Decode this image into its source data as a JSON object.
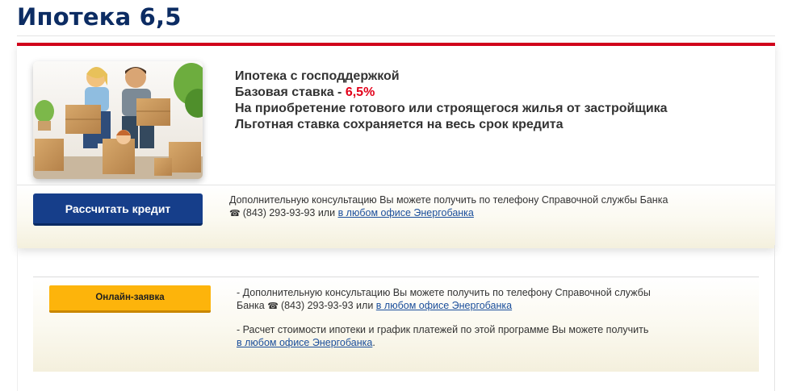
{
  "page": {
    "title": "Ипотека 6,5"
  },
  "card": {
    "features": [
      "Ипотека с господдержкой",
      "Базовая ставка - ",
      "На приобретение готового или строящегося жилья от застройщика",
      "Льготная ставка сохраняется на весь срок кредита"
    ],
    "rate": "6,5%",
    "calc_button": "Рассчитать кредит",
    "consult_text": "Дополнительную консультацию Вы можете получить по телефону Справочной службы Банка",
    "phone": "(843) 293-93-93 или ",
    "office_link": "в любом офисе Энергобанка"
  },
  "block2": {
    "online_button": "Онлайн-заявка",
    "note1_line1": "- Дополнительную консультацию Вы можете получить по телефону Справочной службы",
    "note1_line2": "Банка ",
    "phone": "(843) 293-93-93 или ",
    "office_link": "в любом офисе Энергобанка",
    "note2_line1": "- Расчет стоимости ипотеки и график платежей по этой программе Вы можете получить",
    "office_link2": "в любом офисе Энергобанка",
    "note2_end": "."
  },
  "icons": {
    "phone": "phone-icon"
  },
  "colors": {
    "title": "#0c2c63",
    "accent_red": "#d0021b",
    "rate": "#e2001a",
    "calc_button": "#163e8a",
    "online_button": "#fdb40b",
    "link": "#1a4e9b"
  }
}
